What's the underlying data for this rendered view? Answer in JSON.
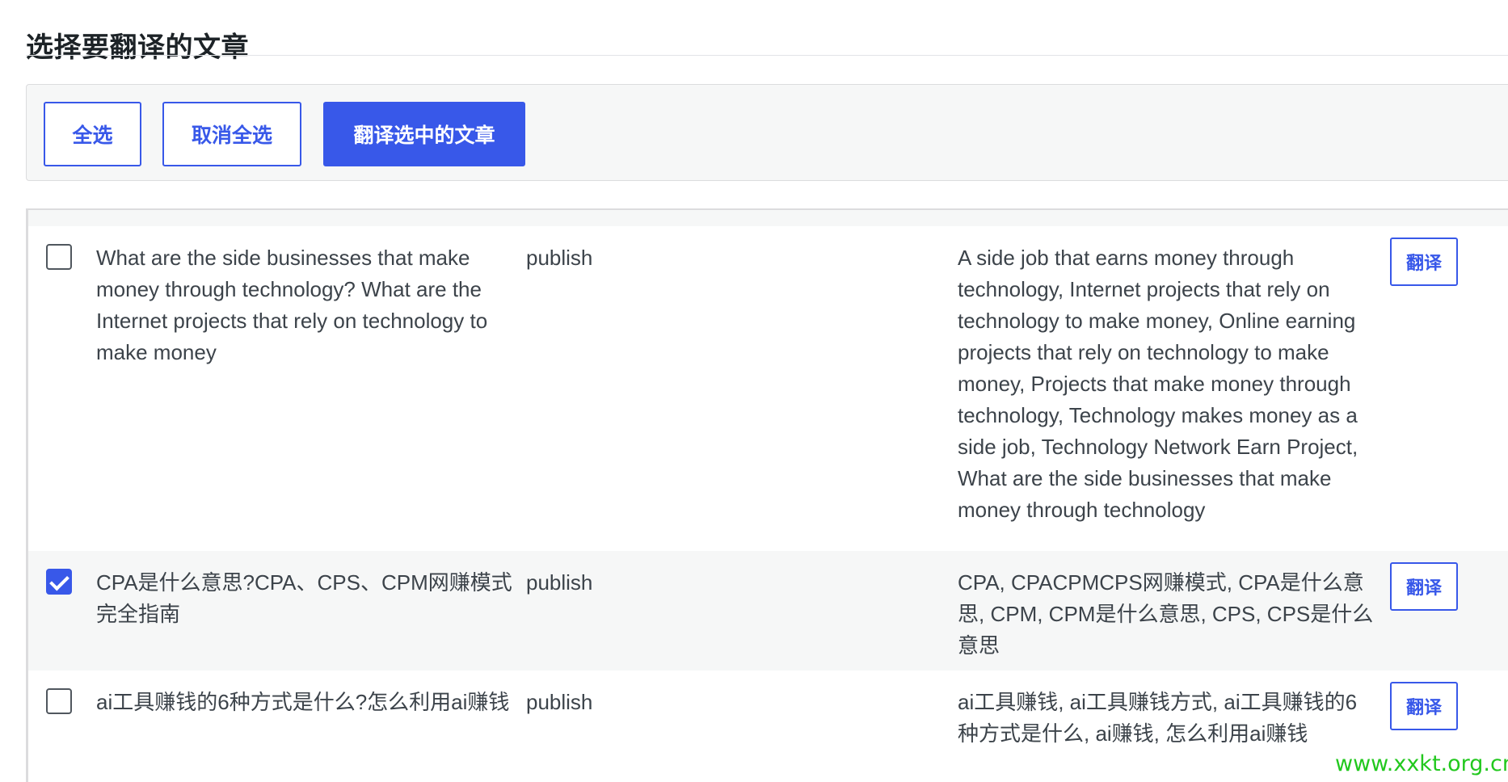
{
  "page": {
    "title": "选择要翻译的文章"
  },
  "toolbar": {
    "select_all_label": "全选",
    "deselect_all_label": "取消全选",
    "translate_selected_label": "翻译选中的文章"
  },
  "posts": [
    {
      "checked": false,
      "title": "What are the side businesses that make money through technology? What are the Internet projects that rely on technology to make money",
      "status": "publish",
      "keywords": "A side job that earns money through technology, Internet projects that rely on technology to make money, Online earning projects that rely on technology to make money, Projects that make money through technology, Technology makes money as a side job, Technology Network Earn Project, What are the side businesses that make money through technology",
      "action_label": "翻译"
    },
    {
      "checked": true,
      "title": "CPA是什么意思?CPA、CPS、CPM网赚模式完全指南",
      "status": "publish",
      "keywords": "CPA, CPACPMCPS网赚模式, CPA是什么意思, CPM, CPM是什么意思, CPS, CPS是什么意思",
      "action_label": "翻译"
    },
    {
      "checked": false,
      "title": "ai工具赚钱的6种方式是什么?怎么利用ai赚钱",
      "status": "publish",
      "keywords": "ai工具赚钱, ai工具赚钱方式, ai工具赚钱的6种方式是什么, ai赚钱, 怎么利用ai赚钱",
      "action_label": "翻译"
    }
  ],
  "watermark": "www.xxkt.org.cn",
  "colors": {
    "accent": "#3858e9",
    "row_alt": "#f6f7f7",
    "text": "#3c434a",
    "watermark": "#22c81e"
  }
}
